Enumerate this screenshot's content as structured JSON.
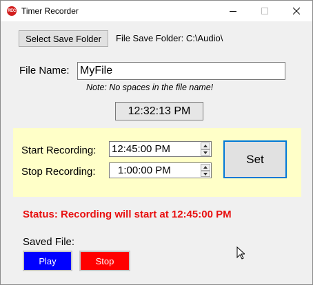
{
  "window": {
    "title": "Timer Recorder",
    "icon_name": "rec-app-icon",
    "icon_text": "REC",
    "controls": [
      "minimize-icon",
      "maximize-icon",
      "close-icon"
    ]
  },
  "folder": {
    "button_label": "Select Save Folder",
    "path_label": "File Save Folder: C:\\Audio\\"
  },
  "file": {
    "label": "File Name:",
    "value": "MyFile",
    "note": "Note: No spaces in the file name!"
  },
  "clock": {
    "time": "12:32:13 PM"
  },
  "schedule": {
    "panel_color": "#ffffc8",
    "start_label": "Start Recording:",
    "start_value": "12:45:00 PM",
    "stop_label": "Stop Recording:",
    "stop_value": "1:00:00 PM",
    "set_label": "Set"
  },
  "status": {
    "text": "Status: Recording will start at 12:45:00 PM",
    "color": "#e81010"
  },
  "saved": {
    "label": "Saved File:",
    "play_label": "Play",
    "play_color": "#0000ff",
    "stop_label": "Stop",
    "stop_color": "#ff0000"
  }
}
